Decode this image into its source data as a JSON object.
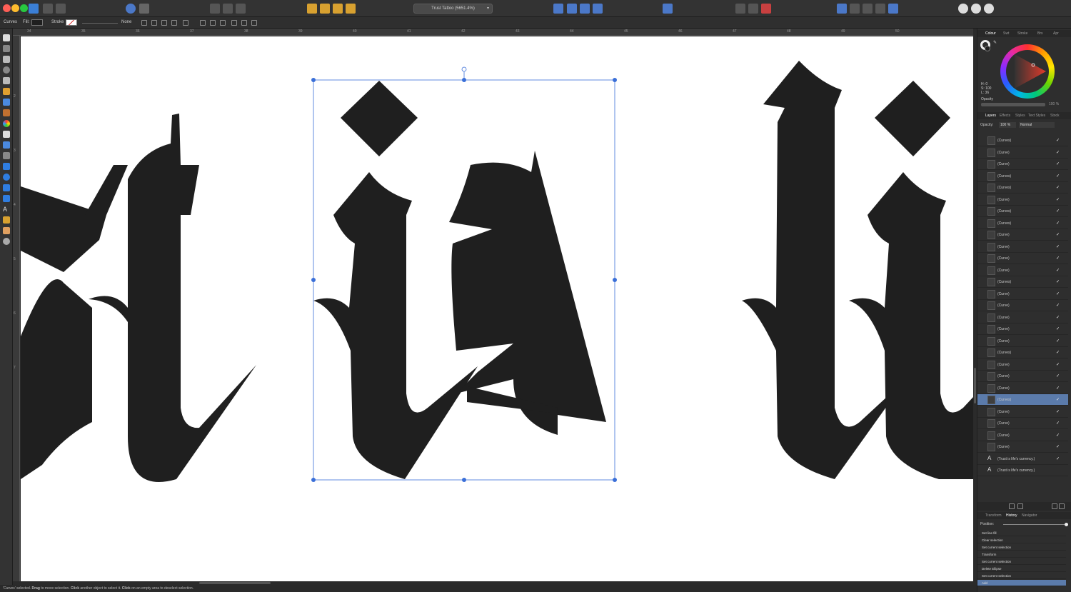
{
  "toolbar": {
    "document_title": "Trust Tattoo (5651.4%)"
  },
  "context": {
    "tool_name": "Curves",
    "fill_label": "Fill:",
    "stroke_label": "Stroke",
    "stroke_value": "None"
  },
  "ruler": {
    "top_ticks": [
      "34",
      "35",
      "36",
      "37",
      "38",
      "39",
      "40",
      "41",
      "42",
      "43",
      "44",
      "45",
      "46",
      "47",
      "48",
      "49",
      "50"
    ],
    "left_ticks": [
      "2",
      "3",
      "4",
      "5",
      "6",
      "7"
    ]
  },
  "status": {
    "part1": "'Curves' selected. ",
    "bold1": "Drag",
    "part2": " to move selection. ",
    "bold2": "Click",
    "part3": " another object to select it. ",
    "bold3": "Click",
    "part4": " on an empty area to deselect selection."
  },
  "color_panel": {
    "tabs": [
      "Colour",
      "Swt",
      "Stroke",
      "Brs",
      "Apr"
    ],
    "h": "H: 0",
    "s": "S: 100",
    "l": "L: 36",
    "opacity_label": "Opacity",
    "opacity_value": "100 %"
  },
  "layers_panel": {
    "tabs": [
      "Layers",
      "Effects",
      "Styles",
      "Text Styles",
      "Stock"
    ],
    "opacity_label": "Opacity:",
    "opacity_value": "100 %",
    "blend_mode": "Normal",
    "rows": [
      {
        "name": "(Curves)",
        "checked": "✓",
        "selected": false
      },
      {
        "name": "(Curve)",
        "checked": "✓",
        "selected": false
      },
      {
        "name": "(Curve)",
        "checked": "✓",
        "selected": false
      },
      {
        "name": "(Curves)",
        "checked": "✓",
        "selected": false
      },
      {
        "name": "(Curves)",
        "checked": "✓",
        "selected": false
      },
      {
        "name": "(Curve)",
        "checked": "✓",
        "selected": false
      },
      {
        "name": "(Curves)",
        "checked": "✓",
        "selected": false
      },
      {
        "name": "(Curves)",
        "checked": "✓",
        "selected": false
      },
      {
        "name": "(Curve)",
        "checked": "✓",
        "selected": false
      },
      {
        "name": "(Curve)",
        "checked": "✓",
        "selected": false
      },
      {
        "name": "(Curve)",
        "checked": "✓",
        "selected": false
      },
      {
        "name": "(Curve)",
        "checked": "✓",
        "selected": false
      },
      {
        "name": "(Curves)",
        "checked": "✓",
        "selected": false
      },
      {
        "name": "(Curve)",
        "checked": "✓",
        "selected": false
      },
      {
        "name": "(Curve)",
        "checked": "✓",
        "selected": false
      },
      {
        "name": "(Curve)",
        "checked": "✓",
        "selected": false
      },
      {
        "name": "(Curve)",
        "checked": "✓",
        "selected": false
      },
      {
        "name": "(Curve)",
        "checked": "✓",
        "selected": false
      },
      {
        "name": "(Curves)",
        "checked": "✓",
        "selected": false
      },
      {
        "name": "(Curve)",
        "checked": "✓",
        "selected": false
      },
      {
        "name": "(Curve)",
        "checked": "✓",
        "selected": false
      },
      {
        "name": "(Curve)",
        "checked": "✓",
        "selected": false
      },
      {
        "name": "(Curves)",
        "checked": "✓",
        "selected": true
      },
      {
        "name": "(Curve)",
        "checked": "✓",
        "selected": false
      },
      {
        "name": "(Curve)",
        "checked": "✓",
        "selected": false
      },
      {
        "name": "(Curve)",
        "checked": "✓",
        "selected": false
      },
      {
        "name": "(Curve)",
        "checked": "✓",
        "selected": false
      },
      {
        "name": "(Trust is life's currency.)",
        "checked": "✓",
        "selected": false
      },
      {
        "name": "(Trust is life's currency.)",
        "checked": "",
        "selected": false
      }
    ]
  },
  "history_panel": {
    "tabs": [
      "Transform",
      "History",
      "Navigator"
    ],
    "position_label": "Position:",
    "items": [
      {
        "label": "Set line fill",
        "selected": false
      },
      {
        "label": "Clear selection",
        "selected": false
      },
      {
        "label": "Set current selection",
        "selected": false
      },
      {
        "label": "Transform",
        "selected": false
      },
      {
        "label": "Set current selection",
        "selected": false
      },
      {
        "label": "Delete Ellipse",
        "selected": false
      },
      {
        "label": "Set current selection",
        "selected": false
      },
      {
        "label": "Add",
        "selected": true
      }
    ]
  },
  "colors": {
    "ink": "#1f1f1f",
    "selection": "#3a6fd8",
    "highlight": "#5b7bab"
  }
}
